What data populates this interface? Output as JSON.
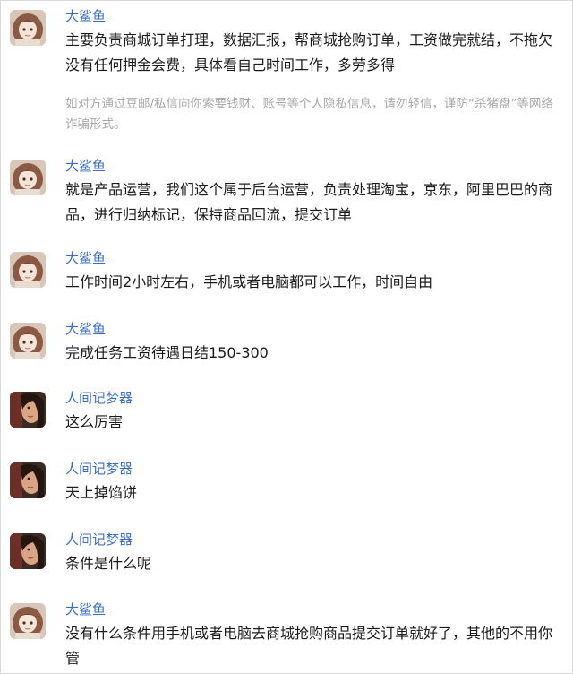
{
  "messages": [
    {
      "sender": "大鲨鱼",
      "avatar_icon": "anime-girl-avatar-icon",
      "text": "主要负责商城订单打理，数据汇报，帮商城抢购订单，工资做完就结，不拖欠没有任何押金会费，具体看自己时间工作，多劳多得",
      "notice": "如对方通过豆邮/私信向你索要钱财、账号等个人隐私信息，请勿轻信，谨防“杀猪盘”等网络诈骗形式。"
    },
    {
      "sender": "大鲨鱼",
      "avatar_icon": "anime-girl-avatar-icon",
      "text": "就是产品运营，我们这个属于后台运营，负责处理淘宝，京东，阿里巴巴的商品，进行归纳标记，保持商品回流，提交订单"
    },
    {
      "sender": "大鲨鱼",
      "avatar_icon": "anime-girl-avatar-icon",
      "text": "工作时间2小时左右，手机或者电脑都可以工作，时间自由"
    },
    {
      "sender": "大鲨鱼",
      "avatar_icon": "anime-girl-avatar-icon",
      "text": "完成任务工资待遇日结150-300"
    },
    {
      "sender": "人间记梦器",
      "avatar_icon": "portrait-photo-avatar-icon",
      "text": "这么厉害"
    },
    {
      "sender": "人间记梦器",
      "avatar_icon": "portrait-photo-avatar-icon",
      "text": "天上掉馅饼"
    },
    {
      "sender": "人间记梦器",
      "avatar_icon": "portrait-photo-avatar-icon",
      "text": "条件是什么呢"
    },
    {
      "sender": "大鲨鱼",
      "avatar_icon": "anime-girl-avatar-icon",
      "text": "没有什么条件用手机或者电脑去商城抢购商品提交订单就好了，其他的不用你管"
    }
  ],
  "colors": {
    "sender_name": "#3b6fc4",
    "message_text": "#1a1a1a",
    "notice_text": "#a8a8a8"
  }
}
